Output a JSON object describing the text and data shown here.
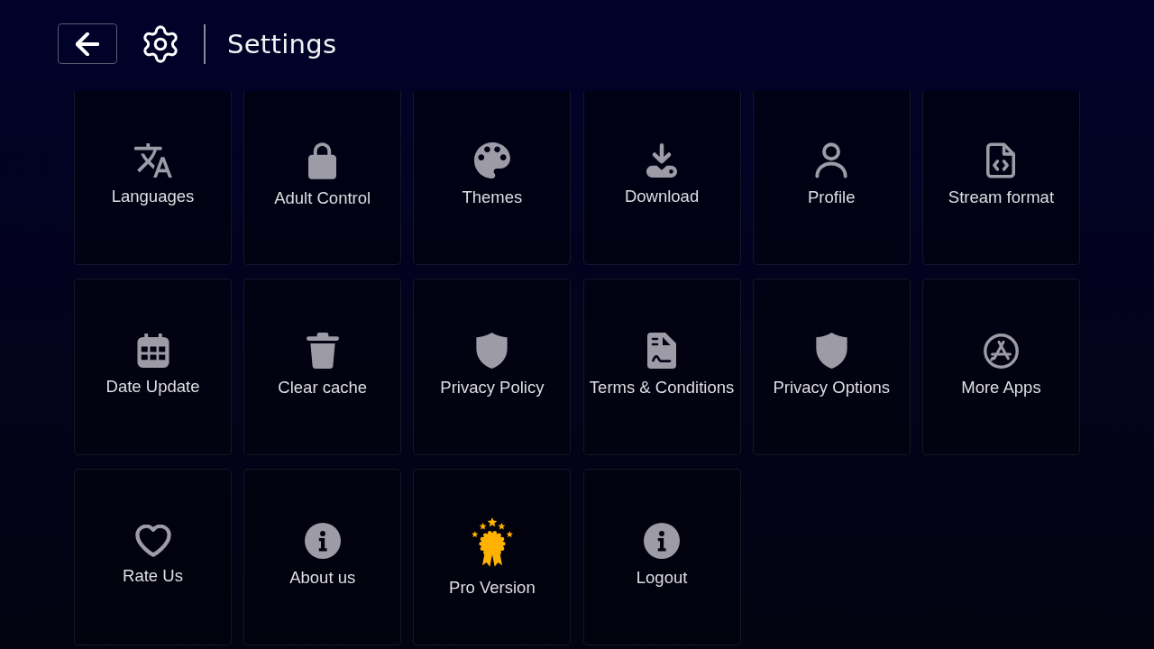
{
  "header": {
    "title": "Settings"
  },
  "items": [
    {
      "label": "Languages"
    },
    {
      "label": "Adult Control"
    },
    {
      "label": "Themes"
    },
    {
      "label": "Download"
    },
    {
      "label": "Profile"
    },
    {
      "label": "Stream format"
    },
    {
      "label": "Date Update"
    },
    {
      "label": "Clear cache"
    },
    {
      "label": "Privacy Policy"
    },
    {
      "label": "Terms & Conditions"
    },
    {
      "label": "Privacy Options"
    },
    {
      "label": "More Apps"
    },
    {
      "label": "Rate Us"
    },
    {
      "label": "About us"
    },
    {
      "label": "Pro Version"
    },
    {
      "label": "Logout"
    }
  ]
}
